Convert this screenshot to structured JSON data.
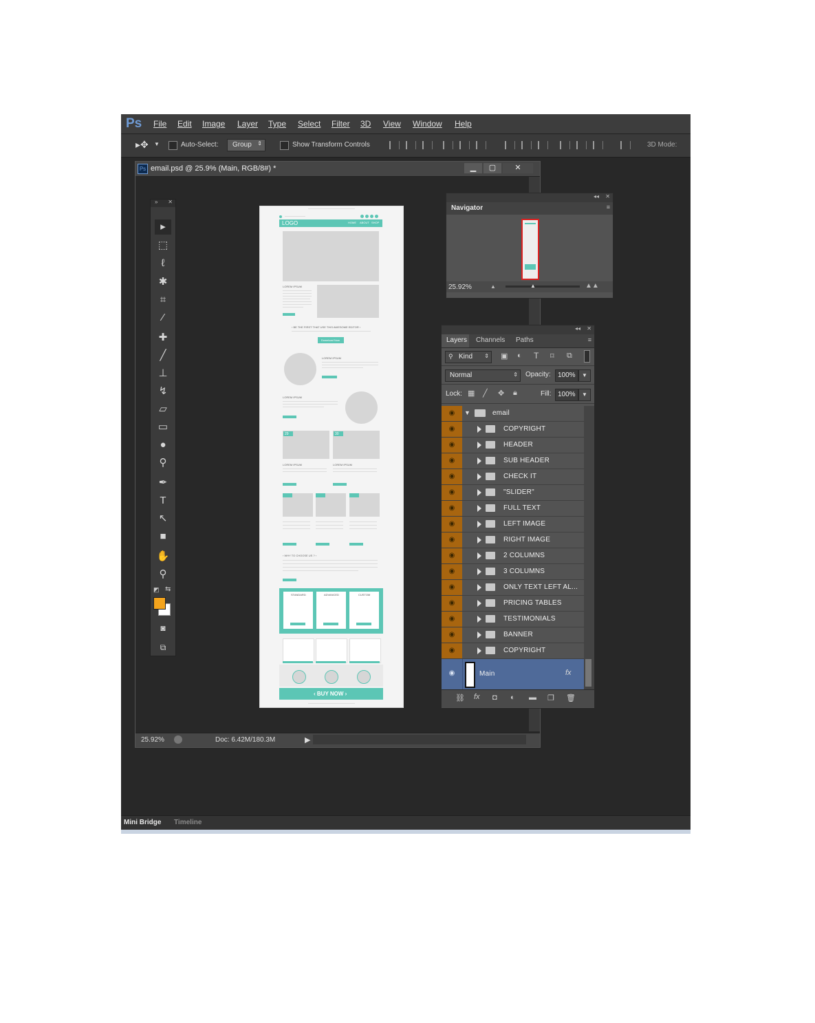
{
  "menubar": {
    "logo": "Ps",
    "items": [
      "File",
      "Edit",
      "Image",
      "Layer",
      "Type",
      "Select",
      "Filter",
      "3D",
      "View",
      "Window",
      "Help"
    ]
  },
  "options": {
    "auto_select": "Auto-Select:",
    "group_select": "Group",
    "show_transform": "Show Transform Controls",
    "mode_3d": "3D Mode:"
  },
  "document": {
    "title": "email.psd @ 25.9% (Main, RGB/8#) *",
    "zoom": "25.92%",
    "doc_size": "Doc: 6.42M/180.3M"
  },
  "email_mock": {
    "logo": "LOGO",
    "nav": [
      "HOME",
      "ABOUT",
      "SHOP"
    ],
    "lorem": "LOREM IPSUM",
    "be_first": "‹ BE THE FIRST THAT USE THIS AWESOME EDITOR ›",
    "download": "Download Now",
    "read_more": "Read More",
    "why": "‹ WHY TO CHOOSE US ? ›",
    "plans": [
      "STANDARD",
      "ADVANCED",
      "CUSTOM"
    ],
    "buy_now": "‹ BUY NOW ›",
    "date_big": "29",
    "date_small": "30"
  },
  "navigator": {
    "title": "Navigator",
    "zoom": "25.92%"
  },
  "layers_panel": {
    "tabs": [
      "Layers",
      "Channels",
      "Paths"
    ],
    "kind": "Kind",
    "blend": "Normal",
    "opacity_label": "Opacity:",
    "opacity": "100%",
    "lock_label": "Lock:",
    "fill_label": "Fill:",
    "fill": "100%",
    "group": "email",
    "layers": [
      "COPYRIGHT",
      "HEADER",
      "SUB HEADER",
      "CHECK IT",
      "\"SLIDER\"",
      "FULL TEXT",
      "LEFT IMAGE",
      "RIGHT IMAGE",
      "2 COLUMNS",
      "3 COLUMNS",
      "ONLY TEXT LEFT AL...",
      "PRICING TABLES",
      "TESTIMONIALS",
      "BANNER",
      "COPYRIGHT"
    ],
    "selected": "Main",
    "fx": "fx"
  },
  "bottom_tabs": [
    "Mini Bridge",
    "Timeline"
  ],
  "colors": {
    "accent_teal": "#5cc6b5",
    "foreground": "#f4a41c",
    "eye_column": "#a8650f",
    "selected_layer": "#4f6a99"
  }
}
